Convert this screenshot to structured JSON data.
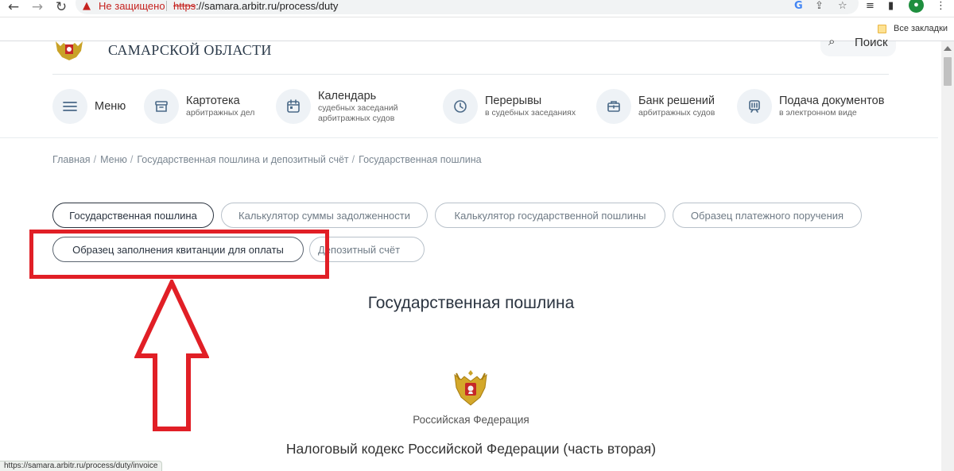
{
  "browser": {
    "security_label": "Не защищено",
    "url_scheme": "https",
    "url_rest": "://samara.arbitr.ru/process/duty",
    "bookmarks_label": "Все закладки",
    "status_url": "https://samara.arbitr.ru/process/duty/invoice"
  },
  "header": {
    "region_title": "САМАРСКОЙ ОБЛАСТИ",
    "search_label": "Поиск"
  },
  "menu": {
    "items": [
      {
        "title": "Меню",
        "sub1": "",
        "sub2": "",
        "icon": "hamburger-icon"
      },
      {
        "title": "Картотека",
        "sub1": "арбитражных дел",
        "sub2": "",
        "icon": "archive-box-icon"
      },
      {
        "title": "Календарь",
        "sub1": "судебных заседаний",
        "sub2": "арбитражных судов",
        "icon": "calendar-icon"
      },
      {
        "title": "Перерывы",
        "sub1": "в судебных заседаниях",
        "sub2": "",
        "icon": "clock-icon"
      },
      {
        "title": "Банк решений",
        "sub1": "арбитражных судов",
        "sub2": "",
        "icon": "briefcase-icon"
      },
      {
        "title": "Подача документов",
        "sub1": "в электронном виде",
        "sub2": "",
        "icon": "document-submit-icon"
      }
    ]
  },
  "breadcrumb": {
    "items": [
      "Главная",
      "Меню",
      "Государственная пошлина и депозитный счёт",
      "Государственная пошлина"
    ]
  },
  "tabs": [
    {
      "label": "Государственная пошлина",
      "active": true
    },
    {
      "label": "Калькулятор суммы задолженности",
      "active": false
    },
    {
      "label": "Калькулятор государственной пошлины",
      "active": false
    },
    {
      "label": "Образец платежного поручения",
      "active": false
    },
    {
      "label": "Образец заполнения квитанции для оплаты",
      "active": false
    },
    {
      "label": "Депозитный счёт",
      "active": false
    }
  ],
  "content": {
    "heading": "Государственная пошлина",
    "country": "Российская Федерация",
    "document_title": "Налоговый кодекс Российской Федерации (часть вторая)"
  },
  "colors": {
    "accent_red": "#e11f26",
    "text_dark": "#2b3440",
    "icon_blue": "#4b6a88"
  }
}
